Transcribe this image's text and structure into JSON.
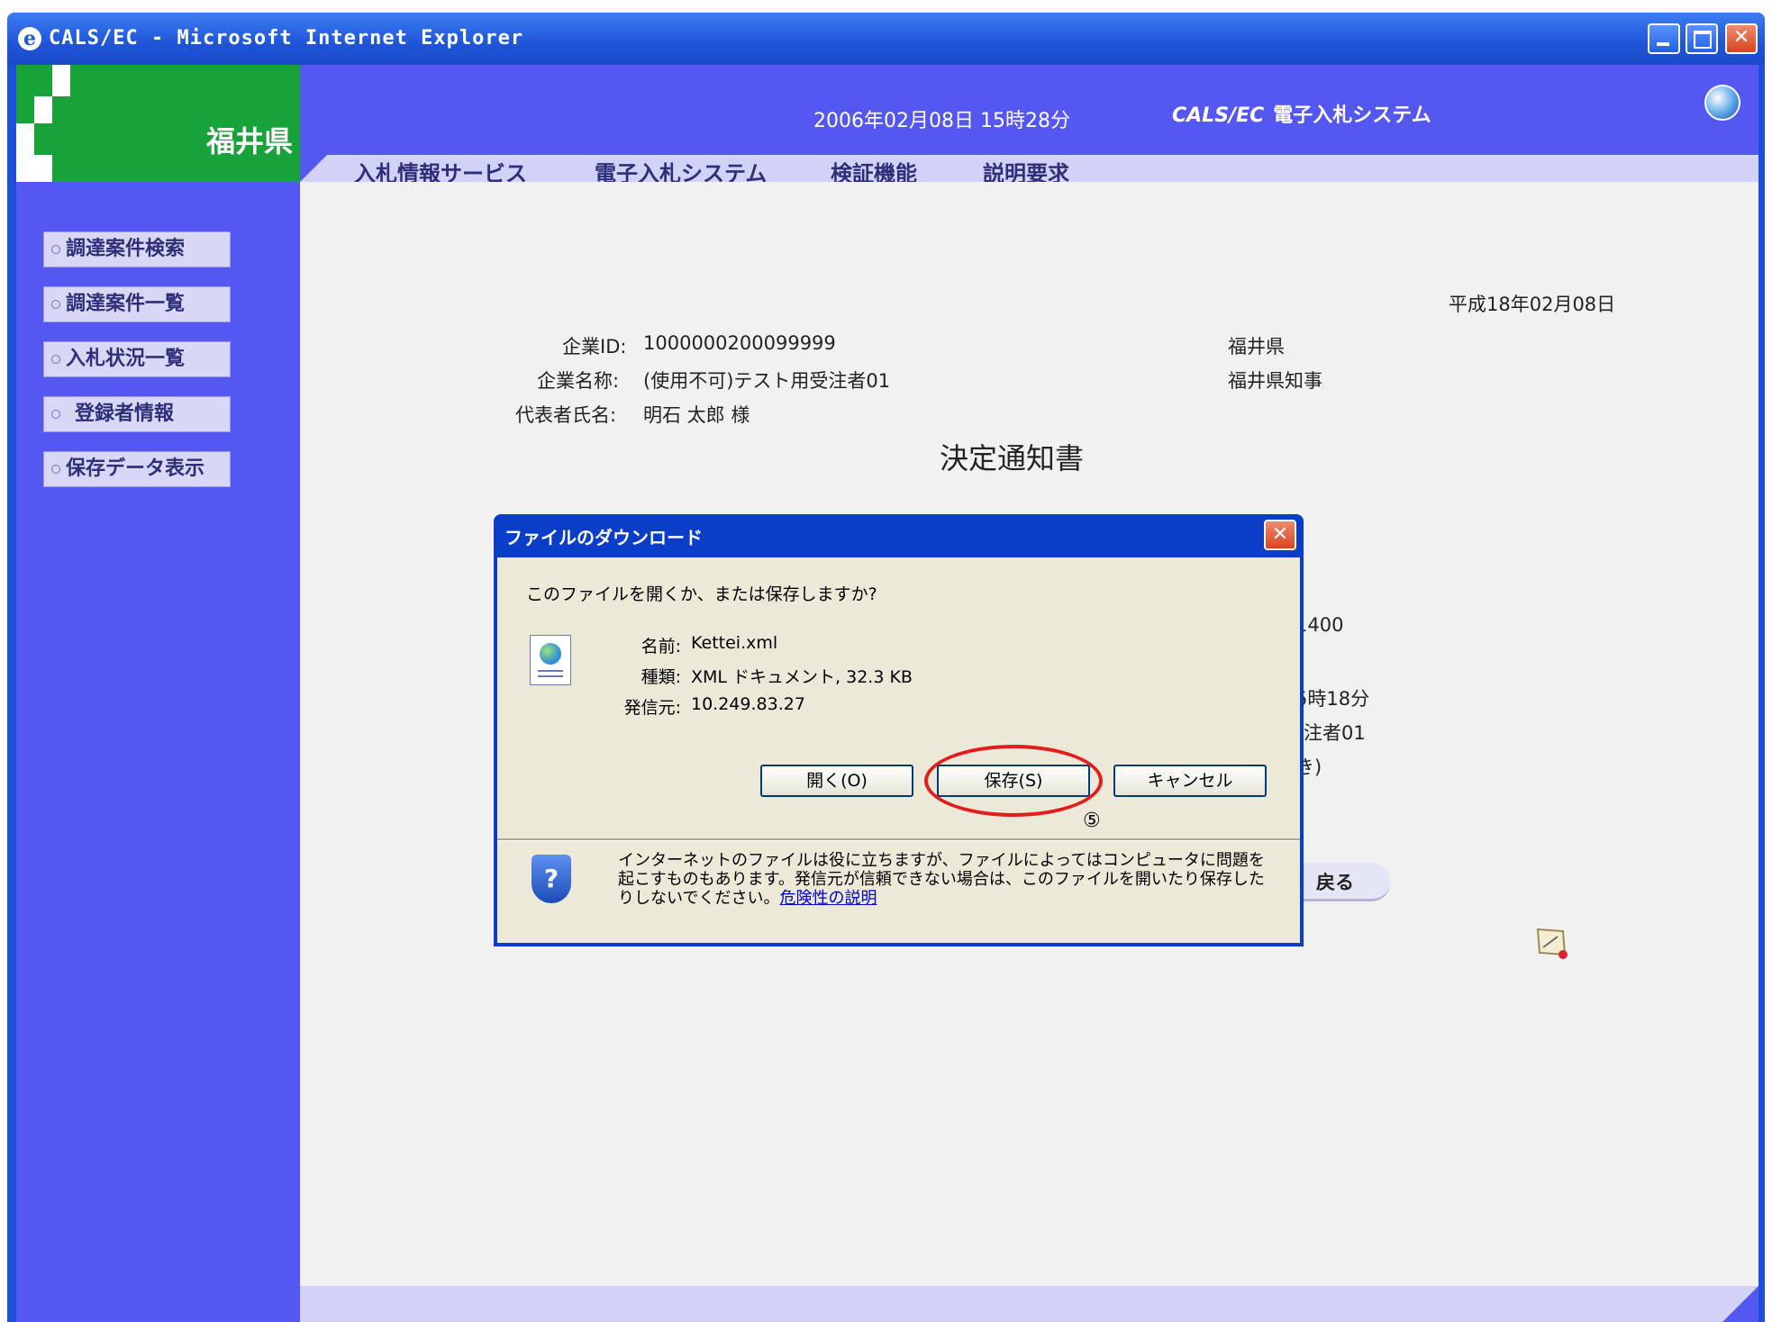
{
  "window": {
    "title": "CALS/EC - Microsoft Internet Explorer"
  },
  "logo": {
    "text": "福井県"
  },
  "header": {
    "datetime": "2006年02月08日 15時28分",
    "system_name_en": "CALS/EC",
    "system_name_ja": "電子入札システム"
  },
  "nav": [
    "入札情報サービス",
    "電子入札システム",
    "検証機能",
    "説明要求"
  ],
  "sidebar": {
    "items": [
      {
        "label": "調達案件検索"
      },
      {
        "label": "調達案件一覧"
      },
      {
        "label": "入札状況一覧"
      },
      {
        "label": "登録者情報"
      },
      {
        "label": "保存データ表示"
      }
    ]
  },
  "document": {
    "date": "平成18年02月08日",
    "company_id_label": "企業ID:",
    "company_id": "1000000200099999",
    "company_name_label": "企業名称:",
    "company_name": "(使用不可)テスト用受注者01",
    "representative_label": "代表者氏名:",
    "representative": "明石 太郎 様",
    "issuer_pref": "福井県",
    "issuer_title": "福井県知事",
    "doc_title_partial": "決定通知書",
    "peek_1": "。",
    "peek_2": "1400",
    "peek_3": "5時18分",
    "peek_4": "受注者01",
    "peek_5": "き)",
    "peek_6": "戻る"
  },
  "dialog": {
    "title": "ファイルのダウンロード",
    "question": "このファイルを開くか、または保存しますか?",
    "name_label": "名前:",
    "name_value": "Kettei.xml",
    "type_label": "種類:",
    "type_value": "XML ドキュメント, 32.3 KB",
    "from_label": "発信元:",
    "from_value": "10.249.83.27",
    "open_label": "開く(O)",
    "save_label": "保存(S)",
    "cancel_label": "キャンセル",
    "annotation": "⑤",
    "warning": "インターネットのファイルは役に立ちますが、ファイルによってはコンピュータに問題を起こすものもあります。発信元が信頼できない場合は、このファイルを開いたり保存したりしないでください。",
    "risk_link": "危険性の説明"
  }
}
